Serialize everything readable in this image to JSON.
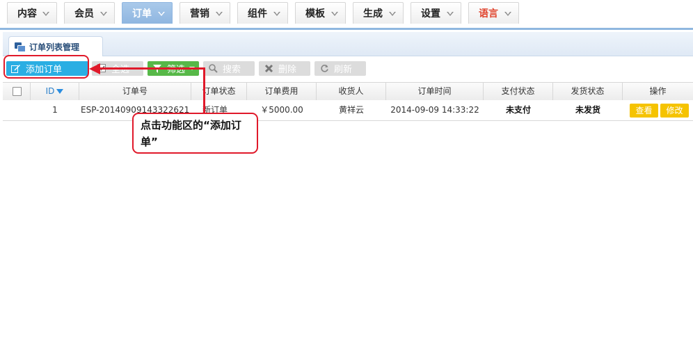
{
  "nav": {
    "items": [
      {
        "label": "内容"
      },
      {
        "label": "会员"
      },
      {
        "label": "订单"
      },
      {
        "label": "营销"
      },
      {
        "label": "组件"
      },
      {
        "label": "模板"
      },
      {
        "label": "生成"
      },
      {
        "label": "设置"
      },
      {
        "label": "语言"
      }
    ],
    "active": "订单"
  },
  "tab": {
    "label": "订单列表管理"
  },
  "toolbar": {
    "add": "添加订单",
    "select_all": "全选",
    "filter": "筛选",
    "search": "搜索",
    "delete": "删除",
    "refresh": "刷新"
  },
  "table": {
    "headers": [
      "ID",
      "订单号",
      "订单状态",
      "订单费用",
      "收货人",
      "订单时间",
      "支付状态",
      "发货状态",
      "操作"
    ],
    "rows": [
      {
        "id": "1",
        "order_no": "ESP-20140909143322621",
        "status": "新订单",
        "fee": "￥5000.00",
        "receiver": "黄祥云",
        "time": "2014-09-09 14:33:22",
        "pay_status": "未支付",
        "ship_status": "未发货",
        "view": "查看",
        "edit": "修改"
      }
    ]
  },
  "annotation": {
    "callout_text": "点击功能区的“添加订单”"
  },
  "colors": {
    "nav_active": "#8fb6e0",
    "add_button": "#2aaee3",
    "filter_button": "#57b848",
    "op_button": "#f5c300",
    "annotation": "#e0192a",
    "lang_text": "#e0452f"
  }
}
